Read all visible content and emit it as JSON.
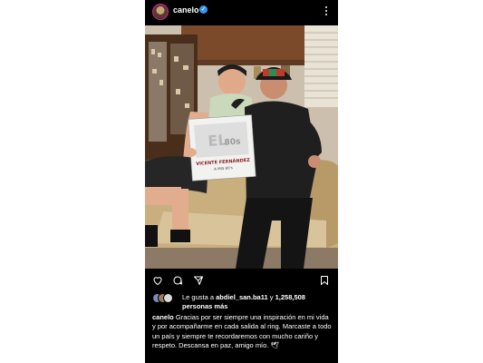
{
  "post": {
    "username": "canelo",
    "verified_glyph": "✓",
    "photo": {
      "album_title": "VICENTE FERNÁNDEZ",
      "album_subtitle": "A MIS 80's",
      "caps_text": [
        "EL",
        "80s"
      ]
    },
    "icons": [
      "heart-icon",
      "comment-icon",
      "share-icon",
      "bookmark-icon",
      "more-icon",
      "verified-icon"
    ],
    "likes": {
      "prefix": "Le gusta a ",
      "user": "abdiel_san.ba11",
      "middle": " y ",
      "count": "1,258,508",
      "suffix": "personas más"
    },
    "caption": {
      "username": "canelo",
      "text": "Gracias por ser siempre una inspiración en mi vida y por acompañarme en cada salida al ring. Marcaste a todo un país y siempre te recordaremos con mucho cariño y respeto. Descansa en paz, amigo mío. 🕊"
    }
  },
  "colors": {
    "background": "#000000",
    "text": "#ffffff",
    "verified": "#3897f0",
    "page": "#ffffff"
  }
}
